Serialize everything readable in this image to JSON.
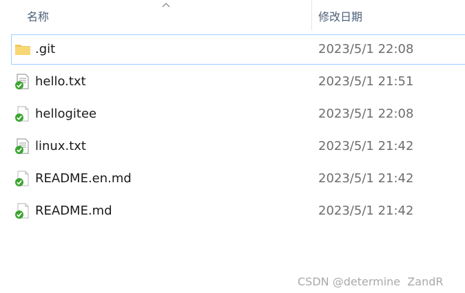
{
  "header": {
    "name_label": "名称",
    "date_label": "修改日期"
  },
  "files": [
    {
      "name": ".git",
      "date": "2023/5/1 22:08",
      "icon": "folder-icon",
      "selected": true
    },
    {
      "name": "hello.txt",
      "date": "2023/5/1 21:51",
      "icon": "text-file-synced-icon",
      "selected": false
    },
    {
      "name": "hellogitee",
      "date": "2023/5/1 22:08",
      "icon": "file-synced-icon",
      "selected": false
    },
    {
      "name": "linux.txt",
      "date": "2023/5/1 21:42",
      "icon": "text-file-synced-icon",
      "selected": false
    },
    {
      "name": "README.en.md",
      "date": "2023/5/1 21:42",
      "icon": "file-synced-icon",
      "selected": false
    },
    {
      "name": "README.md",
      "date": "2023/5/1 21:42",
      "icon": "file-synced-icon",
      "selected": false
    }
  ],
  "watermark": "CSDN @determine  ZandR",
  "colors": {
    "selection_border": "#99d1ff",
    "header_text": "#4c607a",
    "date_text": "#6d6d6d",
    "folder": "#f8d775",
    "sync_check": "#3aa52f"
  }
}
